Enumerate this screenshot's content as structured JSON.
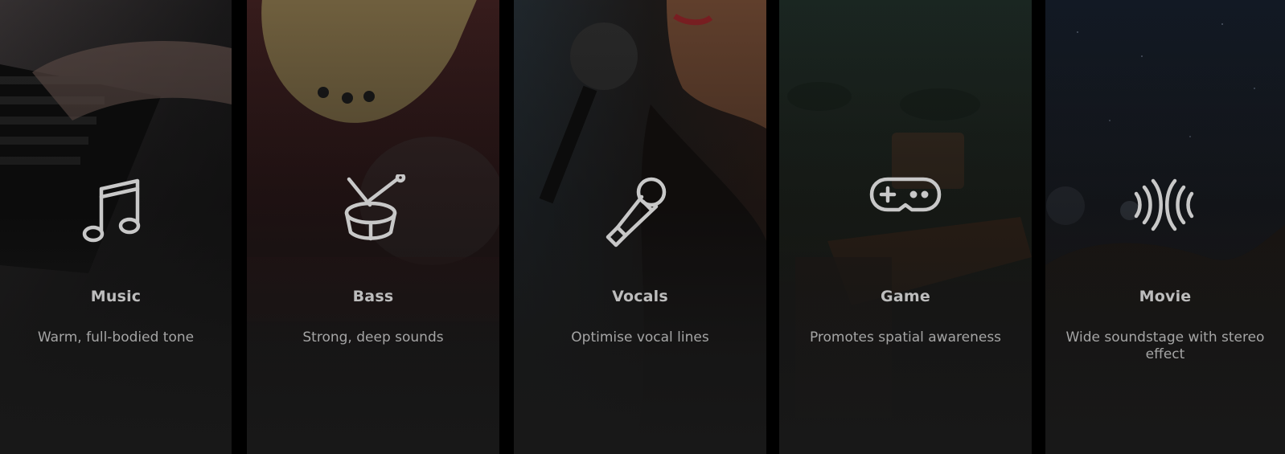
{
  "modes": [
    {
      "title": "Music",
      "description": "Warm, full-bodied tone",
      "icon": "music-note-icon"
    },
    {
      "title": "Bass",
      "description": "Strong, deep sounds",
      "icon": "drum-icon"
    },
    {
      "title": "Vocals",
      "description": "Optimise vocal lines",
      "icon": "microphone-icon"
    },
    {
      "title": "Game",
      "description": "Promotes spatial awareness",
      "icon": "gamepad-icon"
    },
    {
      "title": "Movie",
      "description": "Wide soundstage with stereo effect",
      "icon": "surround-sound-icon"
    }
  ],
  "colors": {
    "icon": "#c8c8c8",
    "title": "#bdbdbd",
    "description": "#a5a5a5",
    "divider": "#000000"
  }
}
